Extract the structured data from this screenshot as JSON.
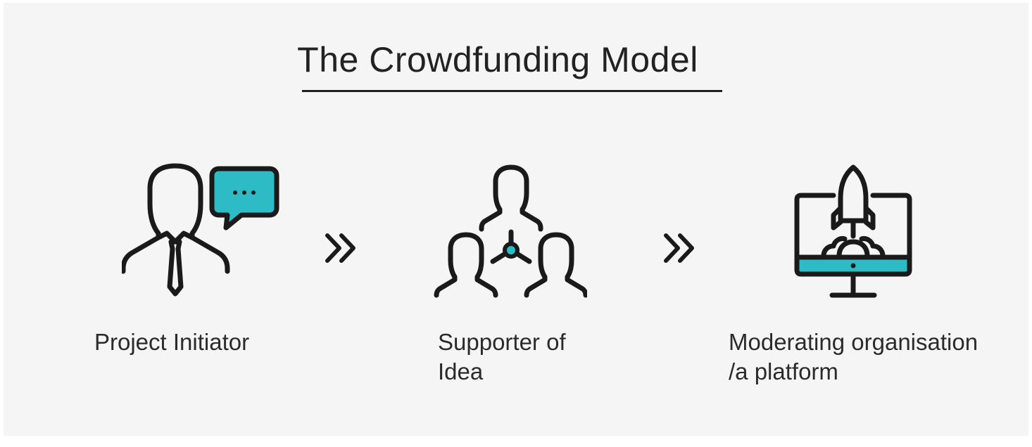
{
  "title": "The Crowdfunding Model",
  "colors": {
    "accent": "#2dbcc6",
    "stroke": "#1a1a1a",
    "background": "#f5f5f5"
  },
  "steps": [
    {
      "icon": "businessman-speech-bubble-icon",
      "label_lines": [
        "Project Initiator"
      ]
    },
    {
      "icon": "people-network-icon",
      "label_lines": [
        "Supporter of",
        "Idea"
      ]
    },
    {
      "icon": "monitor-rocket-icon",
      "label_lines": [
        "Moderating organisation",
        "/a platform"
      ]
    }
  ],
  "connectors": [
    "double-chevron-right-icon",
    "double-chevron-right-icon"
  ]
}
